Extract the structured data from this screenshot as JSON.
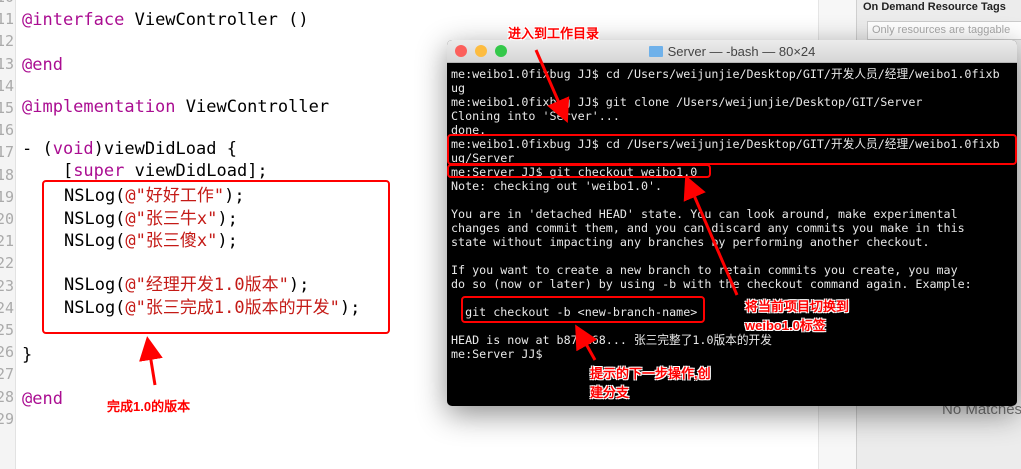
{
  "editor": {
    "line_numbers": [
      "10",
      "11",
      "12",
      "13",
      "14",
      "15",
      "16",
      "17",
      "18",
      "19",
      "20",
      "21",
      "22",
      "23",
      "24",
      "25",
      "26",
      "27",
      "28",
      "29"
    ],
    "lines": {
      "l11": {
        "kw": "@interface",
        "rest": " ViewController ()"
      },
      "l13": {
        "kw": "@end"
      },
      "l15": {
        "kw": "@implementation",
        "rest": " ViewController"
      },
      "l17": {
        "a": "- (",
        "kw": "void",
        "b": ")viewDidLoad {"
      },
      "l18": {
        "a": "    [",
        "kw": "super",
        "b": " viewDidLoad];"
      },
      "logs": [
        {
          "a": "NSLog(",
          "s": "@\"好好工作\"",
          "b": ");"
        },
        {
          "a": "NSLog(",
          "s": "@\"张三牛x\"",
          "b": ");"
        },
        {
          "a": "NSLog(",
          "s": "@\"张三傻x\"",
          "b": ");"
        },
        {
          "a": "NSLog(",
          "s": "@\"经理开发1.0版本\"",
          "b": ");"
        },
        {
          "a": "NSLog(",
          "s": "@\"张三完成1.0版本的开发\"",
          "b": ");"
        }
      ],
      "l26": "}",
      "l28": {
        "kw": "@end"
      }
    }
  },
  "inspector": {
    "title": "On Demand Resource Tags",
    "placeholder": "Only resources are taggable",
    "no_matches": "No Matches"
  },
  "terminal": {
    "title": "Server — -bash — 80×24",
    "lines": [
      "me:weibo1.0fixbug JJ$ cd /Users/weijunjie/Desktop/GIT/开发人员/经理/weibo1.0fixb",
      "ug",
      "me:weibo1.0fixbug JJ$ git clone /Users/weijunjie/Desktop/GIT/Server",
      "Cloning into 'Server'...",
      "done.",
      "me:weibo1.0fixbug JJ$ cd /Users/weijunjie/Desktop/GIT/开发人员/经理/weibo1.0fixb",
      "ug/Server",
      "me:Server JJ$ git checkout weibo1.0",
      "Note: checking out 'weibo1.0'.",
      "",
      "You are in 'detached HEAD' state. You can look around, make experimental",
      "changes and commit them, and you can discard any commits you make in this",
      "state without impacting any branches by performing another checkout.",
      "",
      "If you want to create a new branch to retain commits you create, you may",
      "do so (now or later) by using -b with the checkout command again. Example:",
      "",
      "  git checkout -b <new-branch-name>",
      "",
      "HEAD is now at b872268... 张三完整了1.0版本的开发",
      "me:Server JJ$"
    ]
  },
  "annotations": {
    "workdir": "进入到工作目录",
    "switch_tag": "将当前项目切换到\nweibo1.0标签",
    "next_step": "提示的下一步操作,创\n建分支",
    "done_version": "完成1.0的版本"
  },
  "colors": {
    "annotation": "#ff0000",
    "keyword": "#aa0d91",
    "string": "#c41a16"
  }
}
